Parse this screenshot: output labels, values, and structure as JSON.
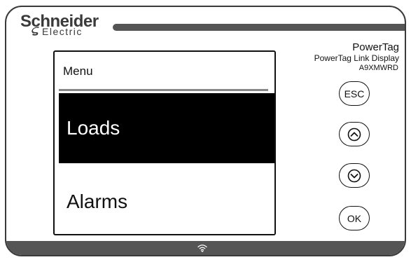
{
  "brand": {
    "name": "Schneider",
    "sub": "Electric"
  },
  "product": {
    "name": "PowerTag",
    "description": "PowerTag Link Display",
    "reference": "A9XMWRD"
  },
  "screen": {
    "title": "Menu",
    "items": [
      {
        "label": "Loads",
        "selected": true
      },
      {
        "label": "Alarms",
        "selected": false
      }
    ]
  },
  "buttons": {
    "esc": "ESC",
    "up_icon": "chevron-up-icon",
    "down_icon": "chevron-down-icon",
    "ok": "OK"
  },
  "status_bar": {
    "icon": "wifi-icon"
  },
  "colors": {
    "frame": "#3a3a3a",
    "bar": "#555555",
    "selection_bg": "#000000",
    "selection_text": "#ffffff"
  }
}
